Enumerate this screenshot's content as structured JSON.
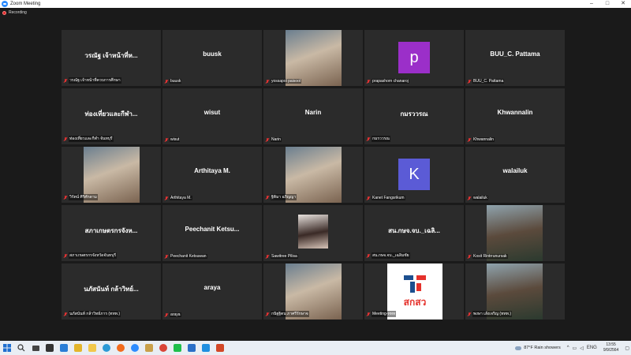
{
  "window": {
    "title": "Zoom Meeting",
    "minimize": "–",
    "maximize": "□",
    "close": "✕"
  },
  "recording": {
    "label": "Recording"
  },
  "tiles": [
    {
      "big": "วรณัฐ เจ้าหน้าที่ห...",
      "label": "วรณัฐ เจ้าหน้าที่ควบการศึกษา",
      "type": "text"
    },
    {
      "big": "buusk",
      "label": "buusk",
      "type": "text"
    },
    {
      "big": "",
      "label": "yossapol paisool",
      "type": "video"
    },
    {
      "big": "p",
      "label": "prapashorn chanaroj",
      "type": "avatar",
      "color": "#9b2fc9"
    },
    {
      "big": "BUU_C. Pattama",
      "label": "BUU_C. Pattama",
      "type": "text"
    },
    {
      "big": "ท่องเที่ยวและกีฬา...",
      "label": "ท่องเที่ยวและกีฬา จันทบุรี",
      "type": "text"
    },
    {
      "big": "wisut",
      "label": "wisut",
      "type": "text"
    },
    {
      "big": "Narin",
      "label": "Narin",
      "type": "text"
    },
    {
      "big": "กมรววรณ",
      "label": "กมรววรณ",
      "type": "text"
    },
    {
      "big": "Khwannalin",
      "label": "Khwannalin",
      "type": "text"
    },
    {
      "big": "",
      "label": "วิรัตน์ ศิริศักดาม",
      "type": "video"
    },
    {
      "big": "Arthitaya M.",
      "label": "Arthitaya M.",
      "type": "text"
    },
    {
      "big": "",
      "label": "ฐิติมา อภิญญา",
      "type": "video"
    },
    {
      "big": "K",
      "label": "Kanet Fangsrikum",
      "type": "avatar",
      "color": "#5b5bd6"
    },
    {
      "big": "walailuk",
      "label": "walailuk",
      "type": "text"
    },
    {
      "big": "สภาเกษตรกรจังห...",
      "label": "สภาเกษตรกรจังหวัดจันทบุรี",
      "type": "text"
    },
    {
      "big": "Peechanit Ketsu...",
      "label": "Peechanit Ketsuwan",
      "type": "text"
    },
    {
      "big": "",
      "label": "Sawitree Pilisa",
      "type": "video-small"
    },
    {
      "big": "สน.กษจ.จบ._เฉลิ...",
      "label": "สน.กษจ.จบ._เฉลิมชัย",
      "type": "text"
    },
    {
      "big": "",
      "label": "Kosit Rintrrunursak",
      "type": "video-right"
    },
    {
      "big": "นภัสนันท์ กล้าวิทย์...",
      "label": "นภัสนันท์ กล้าวิทย์ภาร (ททท.)",
      "type": "text"
    },
    {
      "big": "araya",
      "label": "araya",
      "type": "text"
    },
    {
      "big": "",
      "label": "กนิฐฐิตน ภาศรีรักษาจ",
      "type": "video"
    },
    {
      "big": "",
      "label": "Meeting-ททท",
      "type": "logo",
      "logo_text": "สกสว"
    },
    {
      "big": "",
      "label": "พงษา เส้งเจริญ (ททท.)",
      "type": "video-right"
    }
  ],
  "taskbar": {
    "weather": "87°F  Rain showers",
    "lang": "ENG",
    "time": "13:55",
    "date": "9/9/2564"
  }
}
